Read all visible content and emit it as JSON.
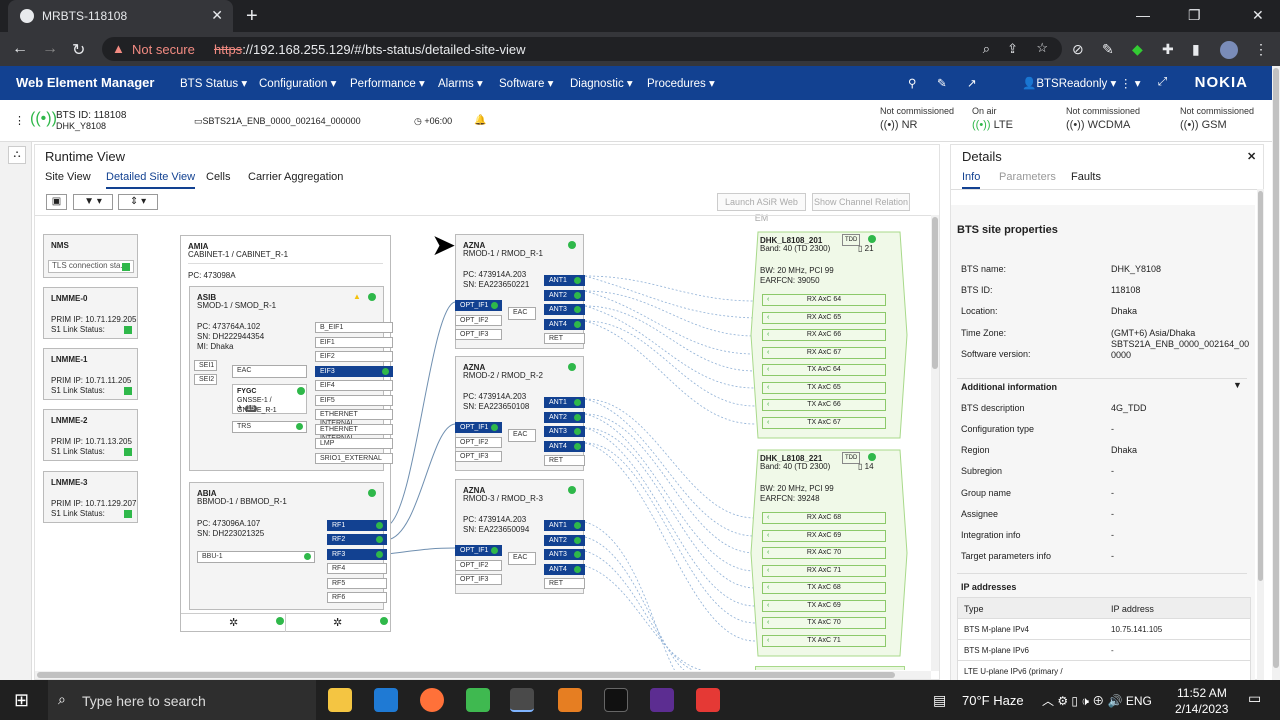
{
  "browser": {
    "tab_title": "MRBTS-118108",
    "url_scheme": "https",
    "url_rest": "://192.168.255.129/#/bts-status/detailed-site-view",
    "not_secure": "Not secure"
  },
  "app": {
    "brand": "Web Element Manager",
    "menus": [
      "BTS Status",
      "Configuration",
      "Performance",
      "Alarms",
      "Software",
      "Diagnostic",
      "Procedures"
    ],
    "user": "BTSReadonly",
    "logo": "NOKIA"
  },
  "infobar": {
    "bts_id": "BTS ID: 118108",
    "bts_name": "DHK_Y8108",
    "sw": "SBTS21A_ENB_0000_002164_000000",
    "tz": "+06:00",
    "rats": [
      {
        "status": "Not commissioned",
        "name": "NR"
      },
      {
        "status": "On air",
        "name": "LTE"
      },
      {
        "status": "Not commissioned",
        "name": "WCDMA"
      },
      {
        "status": "Not commissioned",
        "name": "GSM"
      }
    ]
  },
  "runtime": {
    "title": "Runtime View",
    "tabs": [
      "Site View",
      "Detailed Site View",
      "Cells",
      "Carrier Aggregation"
    ],
    "launch": "Launch ASiR Web EM",
    "show_channel": "Show Channel Relation"
  },
  "left_boxes": [
    {
      "title": "NMS",
      "lines": [
        "TLS connection sta..."
      ]
    },
    {
      "title": "LNMME-0",
      "lines": [
        "PRIM IP: 10.71.129.205",
        "S1 Link Status:"
      ]
    },
    {
      "title": "LNMME-1",
      "lines": [
        "PRIM IP: 10.71.11.205",
        "S1 Link Status:"
      ]
    },
    {
      "title": "LNMME-2",
      "lines": [
        "PRIM IP: 10.71.13.205",
        "S1 Link Status:"
      ]
    },
    {
      "title": "LNMME-3",
      "lines": [
        "PRIM IP: 10.71.129.207",
        "S1 Link Status:"
      ]
    }
  ],
  "cabinet": {
    "type": "AMIA",
    "name": "CABINET-1 / CABINET_R-1",
    "pc": "PC:  473098A",
    "asib": {
      "type": "ASIB",
      "name": "SMOD-1 / SMOD_R-1",
      "pc": "PC:   473764A.102",
      "sn": "SN:   DH222944354",
      "mi": "MI:    Dhaka",
      "eac": "EAC",
      "fygc": "FYGC",
      "fygc_name": "GNSSE-1 / GNSSE_R-1",
      "fygc_badge": "15",
      "trs": "TRS",
      "sei1": "SEI1",
      "sei2": "SEI2",
      "ports": [
        "B_EIF1",
        "EIF1",
        "EIF2",
        "EIF3",
        "EIF4",
        "EIF5",
        "ETHERNET INTERNAL",
        "ETHERNET INTERNAL",
        "LMP",
        "SRIO1_EXTERNAL"
      ]
    },
    "abia": {
      "type": "ABIA",
      "name": "BBMOD-1 / BBMOD_R-1",
      "pc": "PC:   473096A.107",
      "sn": "SN:   DH223021325",
      "bbu": "BBU-1",
      "rf": [
        "RF1",
        "RF2",
        "RF3",
        "RF4",
        "RF5",
        "RF6"
      ]
    }
  },
  "rmods": [
    {
      "type": "AZNA",
      "name": "RMOD-1 / RMOD_R-1",
      "pc": "PC:   473914A.203",
      "sn": "SN:   EA223650221"
    },
    {
      "type": "AZNA",
      "name": "RMOD-2 / RMOD_R-2",
      "pc": "PC:   473914A.203",
      "sn": "SN:   EA223650108"
    },
    {
      "type": "AZNA",
      "name": "RMOD-3 / RMOD_R-3",
      "pc": "PC:   473914A.203",
      "sn": "SN:   EA223650094"
    }
  ],
  "rmod_ports": {
    "opt": [
      "OPT_IF1",
      "OPT_IF2",
      "OPT_IF3"
    ],
    "ant": [
      "ANT1",
      "ANT2",
      "ANT3",
      "ANT4"
    ],
    "eac": "EAC",
    "ret": "RET"
  },
  "cells": [
    {
      "name": "DHK_L8108_201",
      "band": "Band: 40 (TD 2300)",
      "tdd": "TDD",
      "count": "21",
      "bw": "BW: 20 MHz, PCI 99",
      "earfcn": "EARFCN: 39050",
      "carriers": [
        "RX AxC 64",
        "RX AxC 65",
        "RX AxC 66",
        "RX AxC 67",
        "TX AxC 64",
        "TX AxC 65",
        "TX AxC 66",
        "TX AxC 67"
      ]
    },
    {
      "name": "DHK_L8108_221",
      "band": "Band: 40 (TD 2300)",
      "tdd": "TDD",
      "count": "14",
      "bw": "BW: 20 MHz, PCI 99",
      "earfcn": "EARFCN: 39248",
      "carriers": [
        "RX AxC 68",
        "RX AxC 69",
        "RX AxC 70",
        "RX AxC 71",
        "TX AxC 68",
        "TX AxC 69",
        "TX AxC 70",
        "TX AxC 71"
      ]
    }
  ],
  "details": {
    "title": "Details",
    "tabs": [
      "Info",
      "Parameters",
      "Faults"
    ],
    "section": "BTS site properties",
    "props": [
      [
        "BTS name:",
        "DHK_Y8108"
      ],
      [
        "BTS ID:",
        "118108"
      ],
      [
        "Location:",
        "Dhaka"
      ],
      [
        "Time Zone:",
        "(GMT+6) Asia/Dhaka"
      ],
      [
        "Software version:",
        "SBTS21A_ENB_0000_002164_00 0000"
      ]
    ],
    "additional": "Additional information",
    "add_props": [
      [
        "BTS description",
        "4G_TDD"
      ],
      [
        "Configuration type",
        "-"
      ],
      [
        "Region",
        "Dhaka"
      ],
      [
        "Subregion",
        "-"
      ],
      [
        "Group name",
        "-"
      ],
      [
        "Assignee",
        "-"
      ],
      [
        "Integration info",
        "-"
      ],
      [
        "Target parameters info",
        "-"
      ]
    ],
    "ip_title": "IP addresses",
    "ip_head": [
      "Type",
      "IP address"
    ],
    "ips": [
      [
        "BTS M-plane IPv4",
        "10.75.141.105"
      ],
      [
        "BTS M-plane IPv6",
        "-"
      ],
      [
        "LTE U-plane IPv6 (primary /",
        ""
      ]
    ]
  },
  "taskbar": {
    "search": "Type here to search",
    "weather": "70°F  Haze",
    "time": "11:52 AM",
    "date": "2/14/2023"
  },
  "colors": {
    "header": "#124191",
    "green": "#2fb84a"
  }
}
